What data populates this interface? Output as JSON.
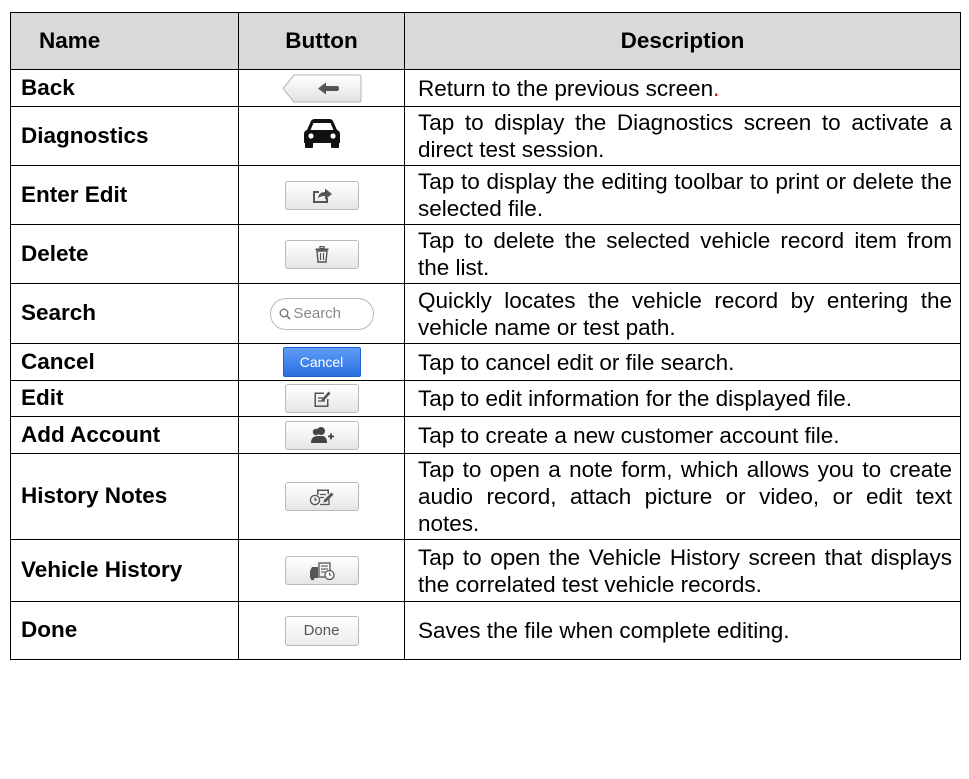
{
  "table": {
    "headers": {
      "name": "Name",
      "button": "Button",
      "description": "Description"
    },
    "rows": [
      {
        "name": "Back",
        "icon": "back-arrow-icon",
        "description": "Return to the previous screen",
        "description_end": "."
      },
      {
        "name": "Diagnostics",
        "icon": "car-icon",
        "description": "Tap to display the Diagnostics screen to activate a direct test session."
      },
      {
        "name": "Enter Edit",
        "icon": "share-export-icon",
        "description": "Tap to display the editing toolbar to print or delete the selected file."
      },
      {
        "name": "Delete",
        "icon": "trash-icon",
        "description": "Tap to delete the selected vehicle record item from the list."
      },
      {
        "name": "Search",
        "icon": "search-icon",
        "button_label": "Search",
        "description": "Quickly locates the vehicle record by entering the vehicle name or test path."
      },
      {
        "name": "Cancel",
        "button_label": "Cancel",
        "description": "Tap to cancel edit or file search."
      },
      {
        "name": "Edit",
        "icon": "edit-note-icon",
        "description": "Tap to edit information for the displayed file."
      },
      {
        "name": "Add Account",
        "icon": "add-user-icon",
        "description": "Tap to create a new customer account file."
      },
      {
        "name": "History Notes",
        "icon": "history-note-icon",
        "description": "Tap to open a note form, which allows you to create audio record, attach picture or video, or edit text notes."
      },
      {
        "name": "Vehicle History",
        "icon": "vehicle-history-icon",
        "description": "Tap to open the Vehicle History screen that displays the correlated test vehicle records."
      },
      {
        "name": "Done",
        "button_label": "Done",
        "description": "Saves the file when complete editing."
      }
    ]
  },
  "colors": {
    "header_bg": "#d9d9d9",
    "cancel_blue": "#2a6fe0",
    "accent_red": "#c00000"
  }
}
